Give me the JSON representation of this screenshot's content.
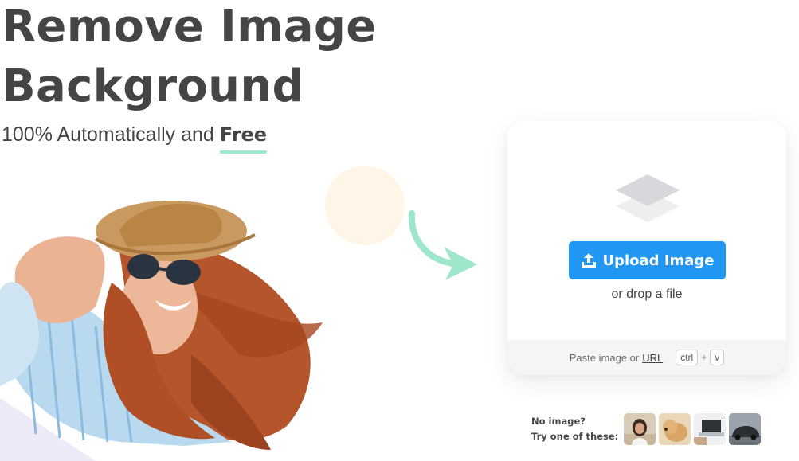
{
  "hero": {
    "title_line1": "Remove Image",
    "title_line2": "Background",
    "subtitle_prefix": "100% Automatically and ",
    "subtitle_highlight": "Free",
    "image_icon": "woman-with-hat-photo"
  },
  "upload": {
    "button_label": "Upload Image",
    "button_icon": "upload-icon",
    "drop_text": "or drop a file",
    "layers_icon": "layers-icon",
    "paste_prefix": "Paste image or ",
    "url_label": "URL",
    "key_ctrl": "ctrl",
    "key_plus": "+",
    "key_v": "v"
  },
  "samples": {
    "line1": "No image?",
    "line2": "Try one of these:",
    "thumbnails": [
      "woman-portrait",
      "dog",
      "laptop-desk",
      "car"
    ]
  },
  "colors": {
    "accent": "#2196f3",
    "highlight": "#9fe7cb",
    "text": "#454545",
    "arrow": "#9fe7cb",
    "circle": "#fff6e7"
  }
}
